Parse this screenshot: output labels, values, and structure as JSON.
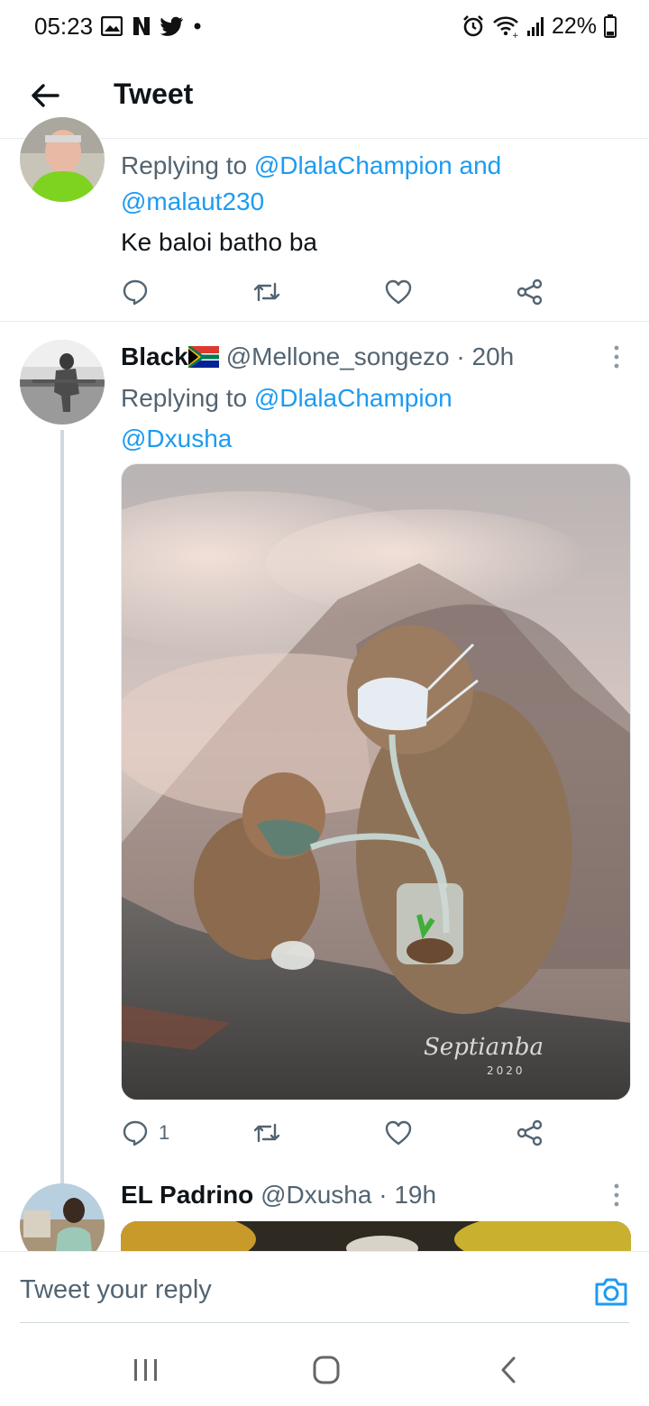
{
  "status_bar": {
    "time": "05:23",
    "battery": "22%",
    "left_icons": [
      "gallery-icon",
      "netflix-icon",
      "twitter-icon",
      "dot-icon"
    ],
    "right_icons": [
      "alarm-icon",
      "wifi-icon",
      "signal-icon",
      "battery-icon"
    ]
  },
  "header": {
    "title": "Tweet"
  },
  "tweets": [
    {
      "reply_prefix": "Replying to ",
      "mention_1": "@DlalaChampion and",
      "mention_2": "@malaut230",
      "text": "Ke baloi batho ba",
      "reply_count": "",
      "actions": [
        "reply-icon",
        "retweet-icon",
        "like-icon",
        "share-icon"
      ]
    },
    {
      "name": "Black",
      "flag": "south-africa-flag-icon",
      "handle": "@Mellone_songezo · 20h",
      "reply_prefix": "Replying to ",
      "mention_1": "@DlalaChampion",
      "mention_2": "@Dxusha",
      "image_signature": "Septianba",
      "image_year": "2020",
      "reply_count": "1",
      "actions": [
        "reply-icon",
        "retweet-icon",
        "like-icon",
        "share-icon"
      ]
    },
    {
      "name": "EL Padrino",
      "handle": "@Dxusha · 19h"
    }
  ],
  "composer": {
    "placeholder": "Tweet your reply"
  },
  "colors": {
    "accent": "#1d9bf0",
    "secondary_text": "#536471",
    "primary_text": "#0f1419"
  }
}
